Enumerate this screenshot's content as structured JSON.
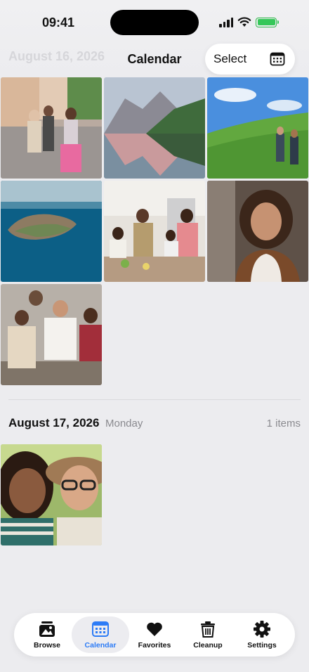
{
  "status_bar": {
    "time": "09:41"
  },
  "header": {
    "ghost_date": "August 16, 2026",
    "title": "Calendar",
    "select_label": "Select",
    "calendar_icon": "calendar-icon"
  },
  "sections": [
    {
      "date": "August 16, 2026",
      "photos": [
        "street-people",
        "mountain-lake",
        "hikers-meadow",
        "island-aerial",
        "family-kitchen",
        "woman-portrait",
        "friends-group"
      ]
    },
    {
      "date": "August 17, 2026",
      "day": "Monday",
      "count": "1 items",
      "photos": [
        "two-friends-selfie"
      ]
    }
  ],
  "tab_bar": {
    "tabs": [
      {
        "label": "Browse",
        "icon": "photo-stack-icon"
      },
      {
        "label": "Calendar",
        "icon": "calendar-icon",
        "active": true
      },
      {
        "label": "Favorites",
        "icon": "heart-icon"
      },
      {
        "label": "Cleanup",
        "icon": "trash-icon"
      },
      {
        "label": "Settings",
        "icon": "gear-icon"
      }
    ]
  },
  "colors": {
    "accent": "#2d7cf6",
    "battery": "#35c759",
    "background": "#ececef"
  }
}
